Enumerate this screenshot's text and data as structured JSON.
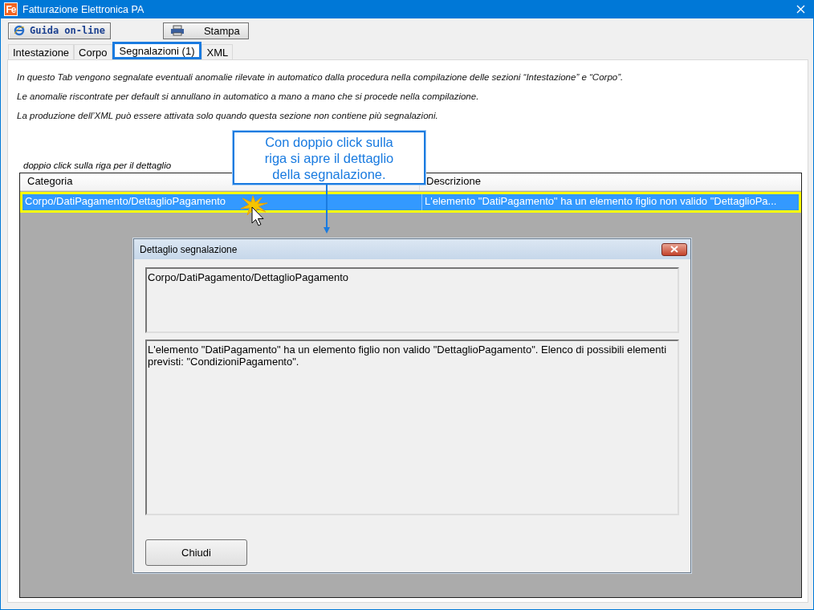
{
  "window": {
    "title": "Fatturazione Elettronica PA",
    "logo_text": "Fe"
  },
  "toolbar": [
    {
      "kind": "help",
      "label": "Guida on-line"
    },
    {
      "kind": "print",
      "label": "Stampa"
    }
  ],
  "tabs": [
    {
      "label": "Intestazione",
      "selected": false
    },
    {
      "label": "Corpo",
      "selected": false
    },
    {
      "label": "Segnalazioni (1)",
      "selected": true
    },
    {
      "label": "XML",
      "selected": false
    }
  ],
  "intro": [
    "In questo Tab vengono segnalate eventuali anomalie rilevate in automatico dalla procedura nella compilazione delle sezioni “Intestazione” e “Corpo”.",
    "Le anomalie riscontrate per default si annullano in automatico a mano a mano che si procede nella compilazione.",
    "La produzione dell’XML può essere attivata solo quando questa sezione non contiene più segnalazioni."
  ],
  "hint": "doppio click sulla riga per il dettaglio",
  "table": {
    "columns": [
      "Categoria",
      "Descrizione"
    ],
    "rows": [
      {
        "cells": [
          "Corpo/DatiPagamento/DettaglioPagamento",
          "L'elemento \"DatiPagamento\" ha un elemento figlio non valido \"DettaglioPa..."
        ],
        "selected": true
      }
    ]
  },
  "callout": "Con doppio click sulla riga si apre il dettaglio della segnalazione.",
  "dialog": {
    "title": "Dettaglio segnalazione",
    "category": "Corpo/DatiPagamento/DettaglioPagamento",
    "description": "L'elemento \"DatiPagamento\" ha un elemento figlio non valido \"DettaglioPagamento\". Elenco di possibili elementi previsti: \"CondizioniPagamento\".",
    "button": "Chiudi"
  }
}
